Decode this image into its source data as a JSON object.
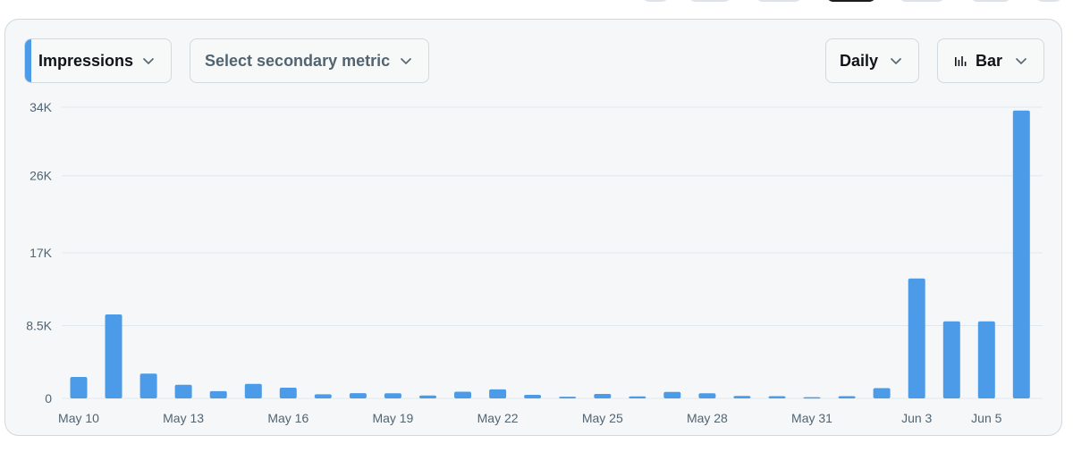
{
  "controls": {
    "primary_metric": "Impressions",
    "secondary_metric_placeholder": "Select secondary metric",
    "interval": "Daily",
    "chart_type_label": "Bar"
  },
  "icons": {
    "chevron": "chevron-down-icon",
    "chart_type": "bar-chart-icon"
  },
  "colors": {
    "bar": "#4c9be8",
    "accent": "#4c9be8",
    "grid": "#e1e8ed",
    "axis_text": "#536471"
  },
  "chart_data": {
    "type": "bar",
    "title": "",
    "xlabel": "",
    "ylabel": "",
    "ylim": [
      0,
      34000
    ],
    "yticks": [
      0,
      8500,
      17000,
      26000,
      34000
    ],
    "ytick_labels": [
      "0",
      "8.5K",
      "17K",
      "26K",
      "34K"
    ],
    "xtick_labels": [
      "May 10",
      "May 13",
      "May 16",
      "May 19",
      "May 22",
      "May 25",
      "May 28",
      "May 31",
      "Jun 3",
      "Jun 5"
    ],
    "xtick_indices": [
      0,
      3,
      6,
      9,
      12,
      15,
      18,
      21,
      24,
      26
    ],
    "grid": true,
    "categories": [
      "May 10",
      "May 11",
      "May 12",
      "May 13",
      "May 14",
      "May 15",
      "May 16",
      "May 17",
      "May 18",
      "May 19",
      "May 20",
      "May 21",
      "May 22",
      "May 23",
      "May 24",
      "May 25",
      "May 26",
      "May 27",
      "May 28",
      "May 29",
      "May 30",
      "May 31",
      "Jun 1",
      "Jun 2",
      "Jun 3",
      "Jun 4",
      "Jun 5",
      "Jun 6"
    ],
    "series": [
      {
        "values": [
          2500,
          9800,
          2900,
          1600,
          850,
          1700,
          1250,
          480,
          620,
          600,
          330,
          780,
          1050,
          420,
          200,
          520,
          230,
          750,
          600,
          280,
          260,
          150,
          260,
          1200,
          14000,
          9000,
          9000,
          33600
        ]
      }
    ]
  }
}
